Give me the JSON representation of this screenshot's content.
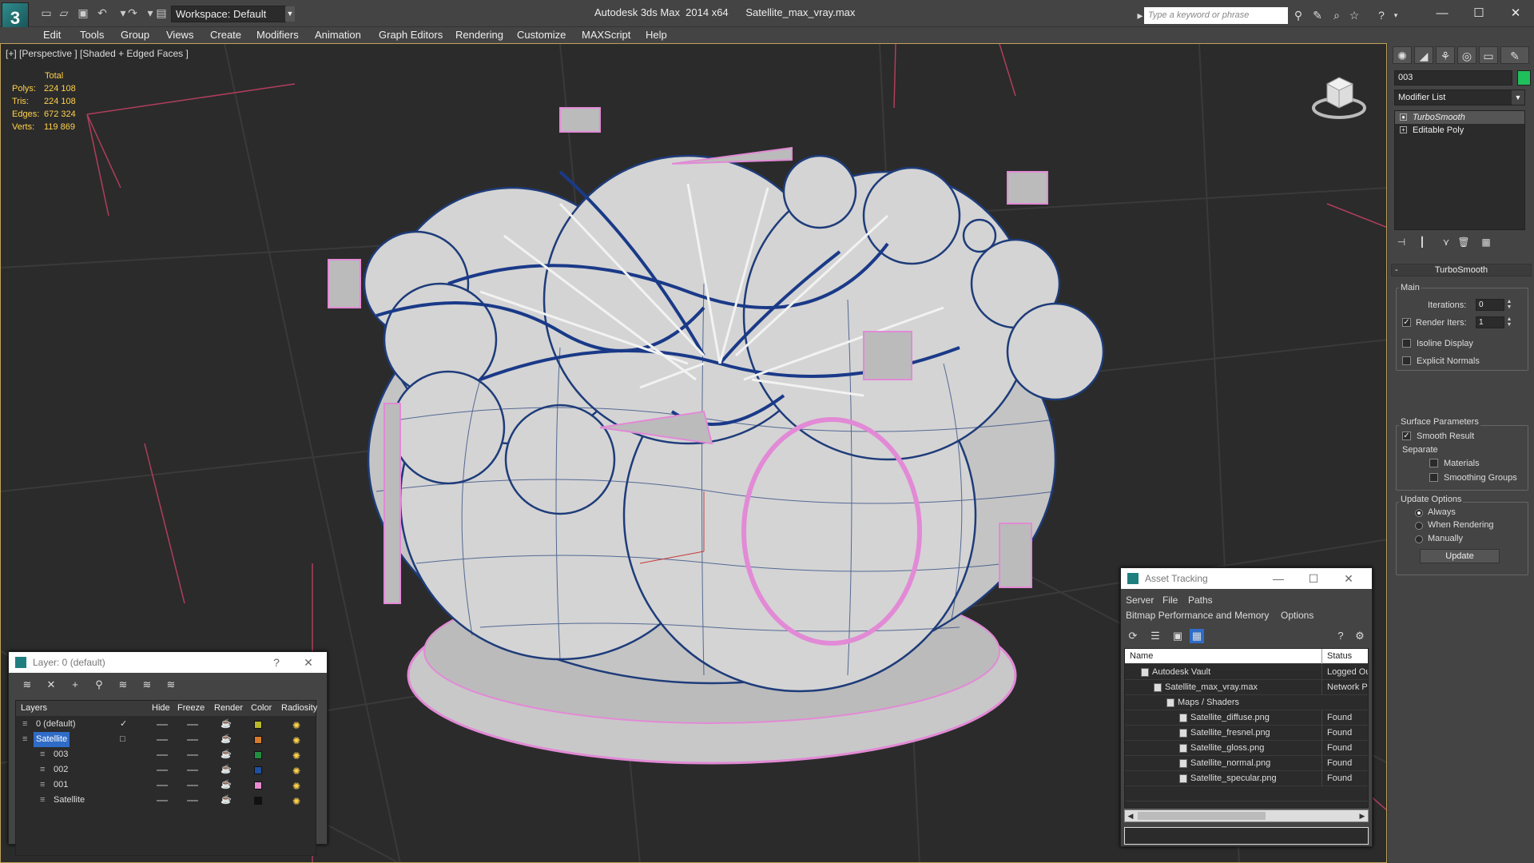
{
  "app": {
    "title": "Autodesk 3ds Max  2014 x64",
    "filename": "Satellite_max_vray.max",
    "logo": "3",
    "workspace": "Workspace: Default",
    "search_placeholder": "Type a keyword or phrase"
  },
  "menu": [
    "Edit",
    "Tools",
    "Group",
    "Views",
    "Create",
    "Modifiers",
    "Animation",
    "Graph Editors",
    "Rendering",
    "Customize",
    "MAXScript",
    "Help"
  ],
  "viewport": {
    "label": "[+] [Perspective ] [Shaded + Edged Faces ]",
    "stats_header": "Total",
    "stats": [
      {
        "label": "Polys:",
        "value": "224 108"
      },
      {
        "label": "Tris:",
        "value": "224 108"
      },
      {
        "label": "Edges:",
        "value": "672 324"
      },
      {
        "label": "Verts:",
        "value": "119 869"
      }
    ]
  },
  "command_panel": {
    "object_name": "003",
    "object_color": "#1fbf5c",
    "modifier_list": "Modifier List",
    "stack": [
      "TurboSmooth",
      "Editable Poly"
    ],
    "rollout_title": "TurboSmooth",
    "main_label": "Main",
    "iterations_label": "Iterations:",
    "iterations_value": "0",
    "render_iters_label": "Render Iters:",
    "render_iters_value": "1",
    "isoline_label": "Isoline Display",
    "explicit_normals_label": "Explicit Normals",
    "surface_params_label": "Surface Parameters",
    "smooth_result_label": "Smooth Result",
    "separate_label": "Separate",
    "materials_label": "Materials",
    "smoothing_groups_label": "Smoothing Groups",
    "update_options_label": "Update Options",
    "always_label": "Always",
    "when_rendering_label": "When Rendering",
    "manually_label": "Manually",
    "update_button": "Update"
  },
  "layer_panel": {
    "title": "Layer: 0 (default)",
    "columns": [
      "Layers",
      "Hide",
      "Freeze",
      "Render",
      "Color",
      "Radiosity"
    ],
    "rows": [
      {
        "name": "0 (default)",
        "color": "#b8b82a",
        "indent": 0,
        "check": "✓",
        "selected": false
      },
      {
        "name": "Satellite",
        "color": "#d87a2a",
        "indent": 0,
        "check": "□",
        "selected": true
      },
      {
        "name": "003",
        "color": "#1f8f3f",
        "indent": 1,
        "check": "",
        "selected": false
      },
      {
        "name": "002",
        "color": "#1f4fa0",
        "indent": 1,
        "check": "",
        "selected": false
      },
      {
        "name": "001",
        "color": "#e88ad0",
        "indent": 1,
        "check": "",
        "selected": false
      },
      {
        "name": "Satellite",
        "color": "#111111",
        "indent": 1,
        "check": "",
        "selected": false
      }
    ]
  },
  "asset_tracking": {
    "title": "Asset Tracking",
    "menu1": [
      "Server",
      "File",
      "Paths"
    ],
    "menu2": [
      "Bitmap Performance and Memory",
      "Options"
    ],
    "columns": [
      "Name",
      "Status"
    ],
    "rows": [
      {
        "name": "Autodesk Vault",
        "status": "Logged Ou",
        "indent": 0
      },
      {
        "name": "Satellite_max_vray.max",
        "status": "Network P",
        "indent": 1
      },
      {
        "name": "Maps / Shaders",
        "status": "",
        "indent": 2
      },
      {
        "name": "Satellite_diffuse.png",
        "status": "Found",
        "indent": 3
      },
      {
        "name": "Satellite_fresnel.png",
        "status": "Found",
        "indent": 3
      },
      {
        "name": "Satellite_gloss.png",
        "status": "Found",
        "indent": 3
      },
      {
        "name": "Satellite_normal.png",
        "status": "Found",
        "indent": 3
      },
      {
        "name": "Satellite_specular.png",
        "status": "Found",
        "indent": 3
      }
    ]
  }
}
